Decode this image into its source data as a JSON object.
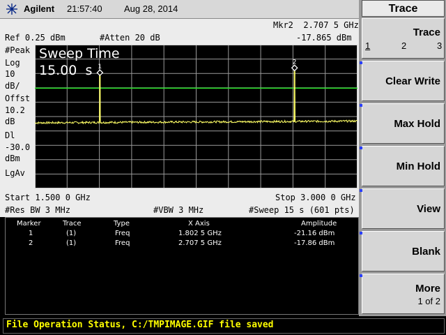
{
  "header": {
    "brand": "Agilent",
    "time": "21:57:40",
    "date": "Aug 28, 2014"
  },
  "screen": {
    "marker_readout_line1": "Mkr2  2.707 5 GHz",
    "ref_level": "Ref 0.25 dBm",
    "attenuation": "#Atten 20 dB",
    "marker_readout_line2": "-17.865 dBm",
    "left_labels": [
      "#Peak",
      "Log",
      "10",
      "dB/",
      "Offst",
      "10.2",
      "dB",
      "Dl",
      "-30.0",
      "dBm",
      "",
      "LgAv"
    ],
    "sweep_time_label": "Sweep Time",
    "sweep_time_value": "15.00  s",
    "start_freq": "Start 1.500 0 GHz",
    "stop_freq": "Stop 3.000 0 GHz",
    "res_bw": "#Res BW 3 MHz",
    "vbw": "#VBW 3 MHz",
    "sweep": "#Sweep 15 s (601 pts)",
    "marker_labels": [
      "1",
      "2"
    ]
  },
  "marker_table": {
    "headers": [
      "Marker",
      "Trace",
      "Type",
      "X Axis",
      "Amplitude"
    ],
    "rows": [
      [
        "1",
        "(1)",
        "Freq",
        "1.802 5 GHz",
        "-21.16 dBm"
      ],
      [
        "2",
        "(1)",
        "Freq",
        "2.707 5 GHz",
        "-17.86 dBm"
      ]
    ]
  },
  "softkeys": {
    "title": "Trace",
    "trace_label": "Trace",
    "trace_options": [
      "1",
      "2",
      "3"
    ],
    "clear_write": "Clear Write",
    "max_hold": "Max Hold",
    "min_hold": "Min Hold",
    "view": "View",
    "blank": "Blank",
    "more": "More",
    "more_page": "1 of 2"
  },
  "status_bar": {
    "message": "File Operation Status, C:/TMPIMAGE.GIF file saved"
  },
  "colors": {
    "trace": "#ffff66",
    "display_line": "#22dd22",
    "status_text": "#ffff00",
    "softkey_tick": "#2a3fff"
  },
  "trace_data": {
    "start_ghz": 1.5,
    "stop_ghz": 3.0,
    "ref_dbm": 0.25,
    "db_per_div": 10,
    "display_line_dbm": -30.0,
    "noise_floor_dbm": -53.5,
    "markers": [
      {
        "label": "1",
        "freq_ghz": 1.8025,
        "amp_dbm": -21.16
      },
      {
        "label": "2",
        "freq_ghz": 2.7075,
        "amp_dbm": -17.86
      }
    ]
  }
}
